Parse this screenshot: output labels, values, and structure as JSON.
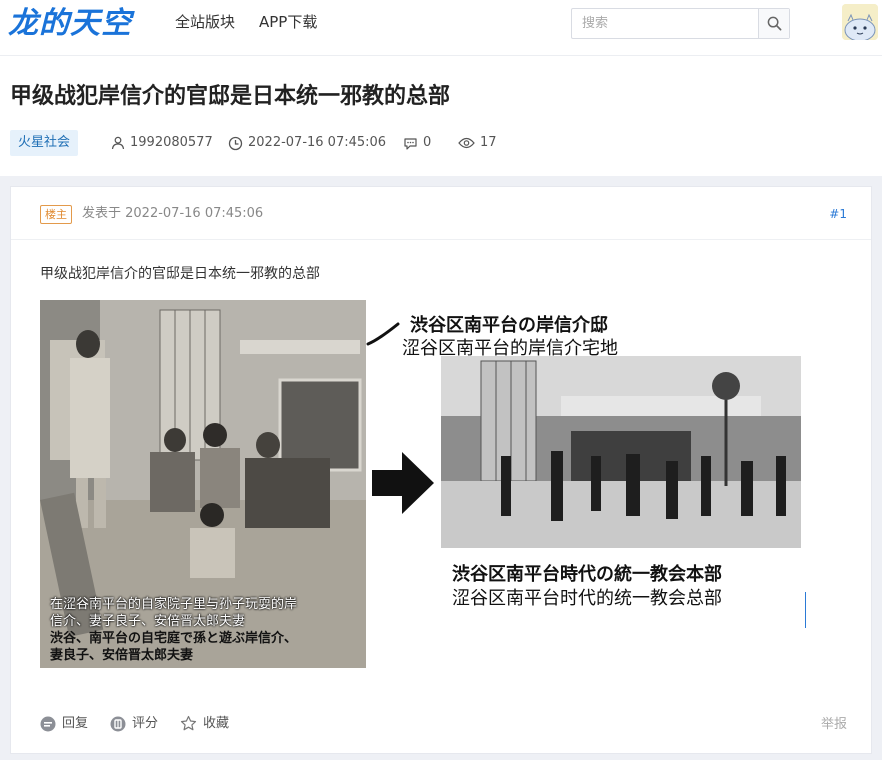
{
  "header": {
    "logo": "龙的天空",
    "nav": [
      "全站版块",
      "APP下载"
    ],
    "search_placeholder": "搜索"
  },
  "post": {
    "title": "甲级战犯岸信介的官邸是日本统一邪教的总部",
    "category": "火星社会",
    "author": "1992080577",
    "datetime": "2022-07-16 07:45:06",
    "comments": "0",
    "views": "17"
  },
  "floor": {
    "badge": "楼主",
    "posted_label": "发表于 2022-07-16 07:45:06",
    "number": "#1",
    "body_text": "甲级战犯岸信介的官邸是日本统一邪教的总部"
  },
  "figure": {
    "top_caption_jp": "渋谷区南平台の岸信介邸",
    "top_caption_cn": "涩谷区南平台的岸信介宅地",
    "left_caption_cn_1": "在涩谷南平台的自家院子里与孙子玩耍的岸",
    "left_caption_cn_2": "信介、妻子良子、安倍晋太郎夫妻",
    "left_caption_jp_1": "渋谷、南平台の自宅庭で孫と遊ぶ岸信介、",
    "left_caption_jp_2": "妻良子、安倍晋太郎夫妻",
    "bottom_caption_jp": "渋谷区南平台時代の統一教会本部",
    "bottom_caption_cn": "涩谷区南平台时代的统一教会总部"
  },
  "actions": {
    "reply": "回复",
    "rate": "评分",
    "favorite": "收藏",
    "report": "举报"
  },
  "colors": {
    "accent": "#1a73d9",
    "category_bg": "#e6f1fb",
    "badge": "#e08a30"
  }
}
